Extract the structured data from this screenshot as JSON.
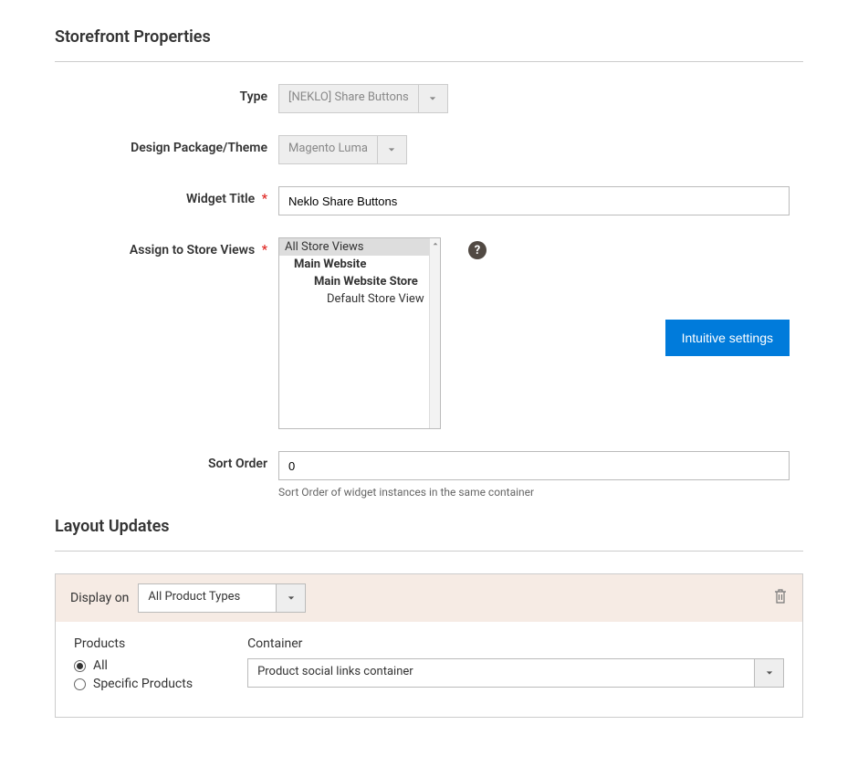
{
  "sections": {
    "storefront": {
      "title": "Storefront Properties"
    },
    "layout": {
      "title": "Layout Updates"
    }
  },
  "storefront": {
    "type": {
      "label": "Type",
      "value": "[NEKLO] Share Buttons"
    },
    "theme": {
      "label": "Design Package/Theme",
      "value": "Magento Luma"
    },
    "widget_title": {
      "label": "Widget Title",
      "value": "Neklo Share Buttons"
    },
    "store_views": {
      "label": "Assign to Store Views",
      "options": [
        {
          "text": "All Store Views",
          "selected": true,
          "bold": false,
          "indent": 0
        },
        {
          "text": "Main Website",
          "selected": false,
          "bold": true,
          "indent": 1
        },
        {
          "text": "Main Website Store",
          "selected": false,
          "bold": true,
          "indent": 2
        },
        {
          "text": "Default Store View",
          "selected": false,
          "bold": false,
          "indent": 3
        }
      ],
      "help_glyph": "?"
    },
    "tooltip_button": "Intuitive settings",
    "sort_order": {
      "label": "Sort Order",
      "value": "0",
      "help": "Sort Order of widget instances in the same container"
    }
  },
  "layout": {
    "display_on": {
      "label": "Display on",
      "value": "All Product Types"
    },
    "products": {
      "label": "Products",
      "options": [
        {
          "text": "All",
          "checked": true
        },
        {
          "text": "Specific Products",
          "checked": false
        }
      ]
    },
    "container": {
      "label": "Container",
      "value": "Product social links container"
    }
  }
}
